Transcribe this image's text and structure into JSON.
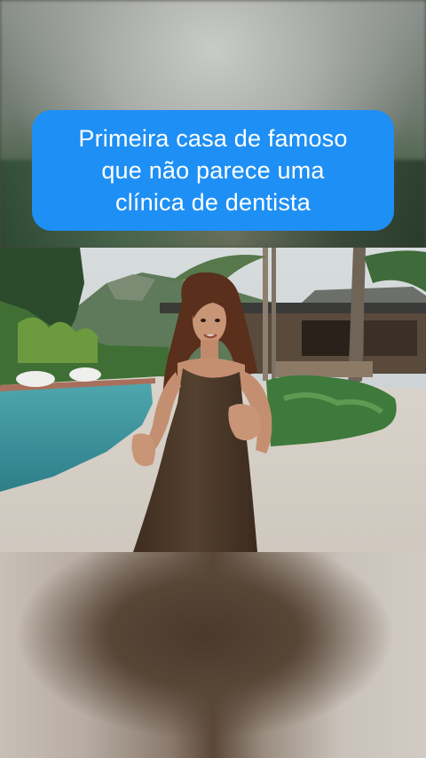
{
  "caption": {
    "line1": "Primeira casa de famoso",
    "line2": "que não parece uma",
    "line3": "clínica de dentista"
  },
  "colors": {
    "caption_bg": "#1e8ff5",
    "caption_text": "#ffffff"
  },
  "scene": {
    "icon": "video-frame",
    "subject": "woman-in-brown-dress"
  }
}
